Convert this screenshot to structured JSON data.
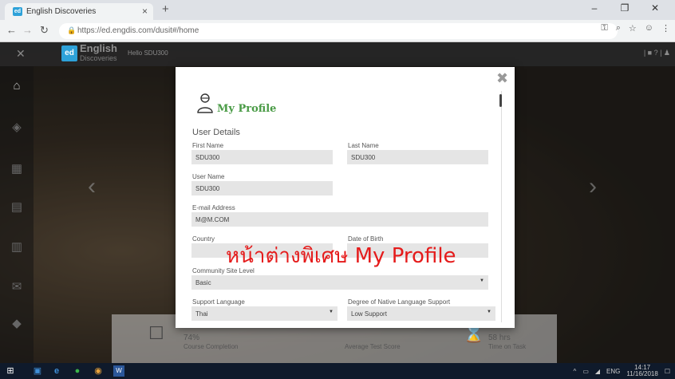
{
  "browser": {
    "tab_title": "English Discoveries",
    "tab_close": "×",
    "new_tab": "+",
    "window_controls": [
      "–",
      "❐",
      "✕"
    ],
    "url": "https://ed.engdis.com/dusit#/home"
  },
  "app": {
    "logo_ed": "ed",
    "logo_word": "English",
    "logo_sub": "Discoveries",
    "greeting": "Hello SDU300",
    "right_controls": "| ■ ? | ♟"
  },
  "modal": {
    "title": "My Profile",
    "section_title": "User Details",
    "fields": {
      "first_name": {
        "label": "First Name",
        "value": "SDU300"
      },
      "last_name": {
        "label": "Last Name",
        "value": "SDU300"
      },
      "user_name": {
        "label": "User Name",
        "value": "SDU300"
      },
      "email": {
        "label": "E-mail Address",
        "value": "M@M.COM"
      },
      "country": {
        "label": "Country",
        "value": ""
      },
      "dob": {
        "label": "Date of Birth",
        "value": ""
      },
      "community_level": {
        "label": "Community Site Level",
        "value": "Basic"
      },
      "support_language": {
        "label": "Support Language",
        "value": "Thai"
      },
      "native_support": {
        "label": "Degree of Native Language Support",
        "value": "Low Support"
      }
    }
  },
  "stats": {
    "completion_value": "74%",
    "completion_label": "Course Completion",
    "avg_score_label": "Average Test Score",
    "time_value": "58 hrs",
    "time_label": "Time on Task"
  },
  "overlay_caption": "หน้าต่างพิเศษ My Profile",
  "taskbar": {
    "language": "ENG",
    "time": "14:17",
    "date": "11/16/2018"
  },
  "colors": {
    "accent_green": "#4a9b46",
    "brand_blue": "#2ea2d9",
    "caption_red": "#e51b1b"
  }
}
